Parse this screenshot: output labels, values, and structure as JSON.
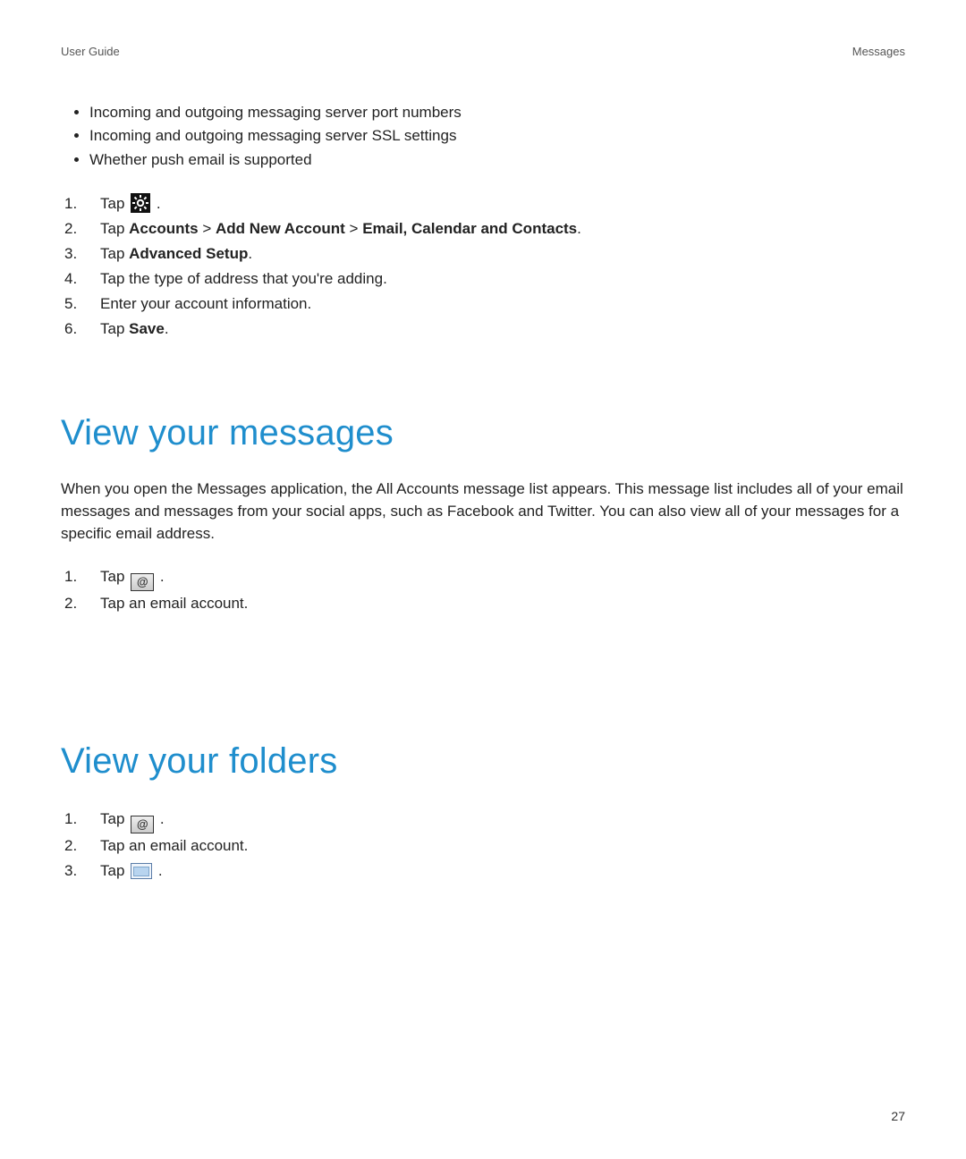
{
  "header": {
    "left": "User Guide",
    "right": "Messages"
  },
  "bullets": [
    "Incoming and outgoing messaging server port numbers",
    "Incoming and outgoing messaging server SSL settings",
    "Whether push email is supported"
  ],
  "stepsA": {
    "n1": "1.",
    "n2": "2.",
    "n3": "3.",
    "n4": "4.",
    "n5": "5.",
    "n6": "6.",
    "s1_pre": "Tap ",
    "s1_post": " .",
    "s2_pre": "Tap ",
    "s2_b1": "Accounts",
    "s2_gt1": " > ",
    "s2_b2": "Add New Account",
    "s2_gt2": " > ",
    "s2_b3": "Email, Calendar and Contacts",
    "s2_post": ".",
    "s3_pre": "Tap ",
    "s3_b": "Advanced Setup",
    "s3_post": ".",
    "s4": "Tap the type of address that you're adding.",
    "s5": "Enter your account information.",
    "s6_pre": "Tap ",
    "s6_b": "Save",
    "s6_post": "."
  },
  "section1": {
    "title": "View your messages",
    "para": "When you open the Messages application, the All Accounts message list appears. This message list includes all of your email messages and messages from your social apps, such as Facebook and Twitter. You can also view all of your messages for a specific email address."
  },
  "stepsB": {
    "n1": "1.",
    "n2": "2.",
    "s1_pre": "Tap ",
    "s1_post": " .",
    "s2": "Tap an email account."
  },
  "section2": {
    "title": "View your folders"
  },
  "stepsC": {
    "n1": "1.",
    "n2": "2.",
    "n3": "3.",
    "s1_pre": "Tap ",
    "s1_post": " .",
    "s2": "Tap an email account.",
    "s3_pre": "Tap ",
    "s3_post": " ."
  },
  "pageNumber": "27",
  "icons": {
    "settings": "settings-icon",
    "at": "@",
    "folder": "folder-icon"
  }
}
